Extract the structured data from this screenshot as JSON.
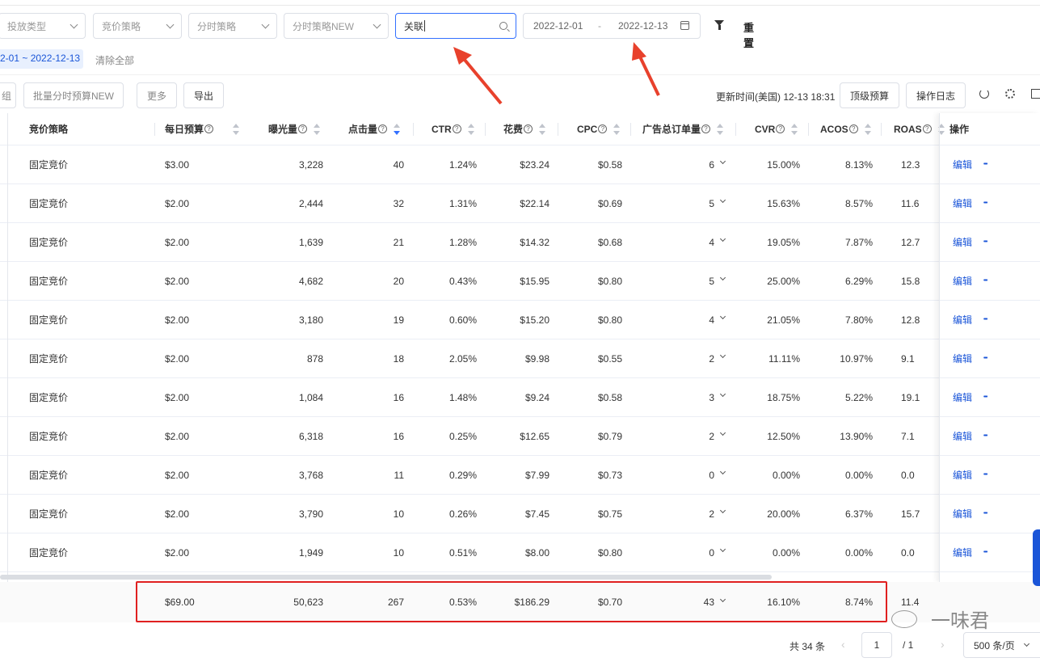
{
  "filters": {
    "placement_type": "投放类型",
    "bid_strategy": "竞价策略",
    "time_strategy": "分时策略",
    "time_strategy_new": "分时策略NEW",
    "search_value": "关联",
    "date_start": "2022-12-01",
    "date_sep": "-",
    "date_end": "2022-12-13",
    "reset_label": "重置"
  },
  "active_filter_chip": "2-01 ~ 2022-12-13",
  "clear_all_label": "清除全部",
  "toolbar": {
    "group_label": "组",
    "batch_time_budget_label": "批量分时预算NEW",
    "more_label": "更多",
    "export_label": "导出",
    "update_time": "更新时间(美国) 12-13 18:31",
    "top_budget_label": "顶级预算",
    "operation_log_label": "操作日志"
  },
  "columns": {
    "bid_strategy": "竞价策略",
    "daily_budget": "每日预算",
    "impressions": "曝光量",
    "clicks": "点击量",
    "ctr": "CTR",
    "spend": "花费",
    "cpc": "CPC",
    "orders": "广告总订单量",
    "cvr": "CVR",
    "acos": "ACOS",
    "roas": "ROAS",
    "actions": "操作"
  },
  "rows": [
    {
      "strategy": "固定竞价",
      "budget": "$3.00",
      "impressions": "3,228",
      "clicks": "40",
      "ctr": "1.24%",
      "spend": "$23.24",
      "cpc": "$0.58",
      "orders": "6",
      "cvr": "15.00%",
      "acos": "8.13%",
      "roas": "12.3",
      "edit": "编辑"
    },
    {
      "strategy": "固定竞价",
      "budget": "$2.00",
      "impressions": "2,444",
      "clicks": "32",
      "ctr": "1.31%",
      "spend": "$22.14",
      "cpc": "$0.69",
      "orders": "5",
      "cvr": "15.63%",
      "acos": "8.57%",
      "roas": "11.6",
      "edit": "编辑"
    },
    {
      "strategy": "固定竞价",
      "budget": "$2.00",
      "impressions": "1,639",
      "clicks": "21",
      "ctr": "1.28%",
      "spend": "$14.32",
      "cpc": "$0.68",
      "orders": "4",
      "cvr": "19.05%",
      "acos": "7.87%",
      "roas": "12.7",
      "edit": "编辑"
    },
    {
      "strategy": "固定竞价",
      "budget": "$2.00",
      "impressions": "4,682",
      "clicks": "20",
      "ctr": "0.43%",
      "spend": "$15.95",
      "cpc": "$0.80",
      "orders": "5",
      "cvr": "25.00%",
      "acos": "6.29%",
      "roas": "15.8",
      "edit": "编辑"
    },
    {
      "strategy": "固定竞价",
      "budget": "$2.00",
      "impressions": "3,180",
      "clicks": "19",
      "ctr": "0.60%",
      "spend": "$15.20",
      "cpc": "$0.80",
      "orders": "4",
      "cvr": "21.05%",
      "acos": "7.80%",
      "roas": "12.8",
      "edit": "编辑"
    },
    {
      "strategy": "固定竞价",
      "budget": "$2.00",
      "impressions": "878",
      "clicks": "18",
      "ctr": "2.05%",
      "spend": "$9.98",
      "cpc": "$0.55",
      "orders": "2",
      "cvr": "11.11%",
      "acos": "10.97%",
      "roas": "9.1",
      "edit": "编辑"
    },
    {
      "strategy": "固定竞价",
      "budget": "$2.00",
      "impressions": "1,084",
      "clicks": "16",
      "ctr": "1.48%",
      "spend": "$9.24",
      "cpc": "$0.58",
      "orders": "3",
      "cvr": "18.75%",
      "acos": "5.22%",
      "roas": "19.1",
      "edit": "编辑"
    },
    {
      "strategy": "固定竞价",
      "budget": "$2.00",
      "impressions": "6,318",
      "clicks": "16",
      "ctr": "0.25%",
      "spend": "$12.65",
      "cpc": "$0.79",
      "orders": "2",
      "cvr": "12.50%",
      "acos": "13.90%",
      "roas": "7.1",
      "edit": "编辑"
    },
    {
      "strategy": "固定竞价",
      "budget": "$2.00",
      "impressions": "3,768",
      "clicks": "11",
      "ctr": "0.29%",
      "spend": "$7.99",
      "cpc": "$0.73",
      "orders": "0",
      "cvr": "0.00%",
      "acos": "0.00%",
      "roas": "0.0",
      "edit": "编辑"
    },
    {
      "strategy": "固定竞价",
      "budget": "$2.00",
      "impressions": "3,790",
      "clicks": "10",
      "ctr": "0.26%",
      "spend": "$7.45",
      "cpc": "$0.75",
      "orders": "2",
      "cvr": "20.00%",
      "acos": "6.37%",
      "roas": "15.7",
      "edit": "编辑"
    },
    {
      "strategy": "固定竞价",
      "budget": "$2.00",
      "impressions": "1,949",
      "clicks": "10",
      "ctr": "0.51%",
      "spend": "$8.00",
      "cpc": "$0.80",
      "orders": "0",
      "cvr": "0.00%",
      "acos": "0.00%",
      "roas": "0.0",
      "edit": "编辑"
    }
  ],
  "totals": {
    "budget": "$69.00",
    "impressions": "50,623",
    "clicks": "267",
    "ctr": "0.53%",
    "spend": "$186.29",
    "cpc": "$0.70",
    "orders": "43",
    "cvr": "16.10%",
    "acos": "8.74%",
    "roas": "11.4"
  },
  "pagination": {
    "total_label": "共 34 条",
    "current_page": "1",
    "total_pages": "/ 1",
    "page_size": "500 条/页"
  },
  "watermark": "一味君",
  "colors": {
    "accent": "#3370ff",
    "link": "#1a55d8",
    "highlight_box": "#e02020"
  }
}
